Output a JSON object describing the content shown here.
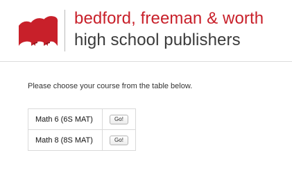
{
  "header": {
    "brand_line1": "bedford, freeman & worth",
    "brand_line2": "high school publishers",
    "logo_icon": "macmillan-m-logo-icon",
    "brand_color": "#c8202a"
  },
  "main": {
    "instructions": "Please choose your course from the table below.",
    "courses": [
      {
        "name": "Math 6 (6S MAT)",
        "button_label": "Go!"
      },
      {
        "name": "Math 8 (8S MAT)",
        "button_label": "Go!"
      }
    ]
  }
}
